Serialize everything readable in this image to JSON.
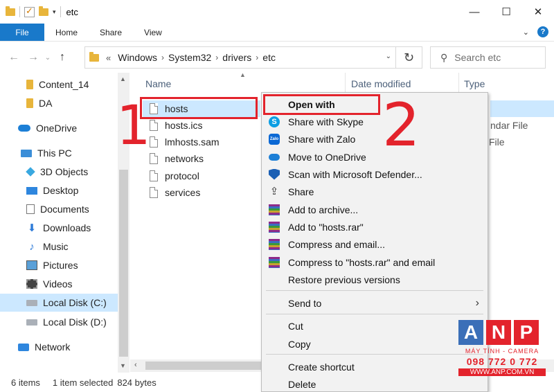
{
  "window": {
    "title": "etc",
    "minimize_icon": "minimize-icon",
    "maximize_icon": "maximize-icon",
    "close_icon": "close-icon"
  },
  "ribbon": {
    "tabs": [
      {
        "label": "File"
      },
      {
        "label": "Home"
      },
      {
        "label": "Share"
      },
      {
        "label": "View"
      }
    ],
    "help_glyph": "?"
  },
  "address": {
    "prefix": "«",
    "crumbs": [
      "Windows",
      "System32",
      "drivers",
      "etc"
    ],
    "search_placeholder": "Search etc"
  },
  "nav": {
    "items": [
      {
        "label": "Content_14",
        "icon": "folder-icon"
      },
      {
        "label": "DA",
        "icon": "folder-icon"
      },
      {
        "label": "OneDrive",
        "icon": "onedrive-icon"
      },
      {
        "label": "This PC",
        "icon": "pc-icon"
      },
      {
        "label": "3D Objects",
        "icon": "cube-icon"
      },
      {
        "label": "Desktop",
        "icon": "desktop-icon"
      },
      {
        "label": "Documents",
        "icon": "documents-icon"
      },
      {
        "label": "Downloads",
        "icon": "download-icon"
      },
      {
        "label": "Music",
        "icon": "music-icon"
      },
      {
        "label": "Pictures",
        "icon": "pictures-icon"
      },
      {
        "label": "Videos",
        "icon": "videos-icon"
      },
      {
        "label": "Local Disk (C:)",
        "icon": "disk-icon",
        "selected": true
      },
      {
        "label": "Local Disk (D:)",
        "icon": "disk-icon"
      },
      {
        "label": "Network",
        "icon": "network-icon"
      }
    ]
  },
  "files": {
    "columns": [
      "Name",
      "Date modified",
      "Type"
    ],
    "items": [
      {
        "name": "hosts",
        "selected": true
      },
      {
        "name": "hosts.ics"
      },
      {
        "name": "lmhosts.sam"
      },
      {
        "name": "networks"
      },
      {
        "name": "protocol"
      },
      {
        "name": "services"
      }
    ],
    "type_fragments": [
      "ndar File",
      "File"
    ]
  },
  "status": {
    "count": "6 items",
    "selected": "1 item selected",
    "size": "824 bytes"
  },
  "context_menu": {
    "items": [
      {
        "label": "Open with",
        "icon": "none"
      },
      {
        "label": "Share with Skype",
        "icon": "skype-icon"
      },
      {
        "label": "Share with Zalo",
        "icon": "zalo-icon"
      },
      {
        "label": "Move to OneDrive",
        "icon": "onedrive-icon"
      },
      {
        "label": "Scan with Microsoft Defender...",
        "icon": "defender-icon"
      },
      {
        "label": "Share",
        "icon": "share-icon"
      },
      {
        "label": "Add to archive...",
        "icon": "winrar-icon"
      },
      {
        "label": "Add to \"hosts.rar\"",
        "icon": "winrar-icon"
      },
      {
        "label": "Compress and email...",
        "icon": "winrar-icon"
      },
      {
        "label": "Compress to \"hosts.rar\" and email",
        "icon": "winrar-icon"
      },
      {
        "label": "Restore previous versions",
        "icon": "none"
      },
      {
        "label": "Send to",
        "icon": "none"
      },
      {
        "label": "Cut",
        "icon": "none"
      },
      {
        "label": "Copy",
        "icon": "none"
      },
      {
        "label": "Create shortcut",
        "icon": "none"
      },
      {
        "label": "Delete",
        "icon": "none"
      }
    ],
    "zalo_glyph": "Zalo",
    "skype_glyph": "S"
  },
  "annotations": {
    "step1": "1",
    "step2": "2",
    "accent_color": "#e3232c"
  },
  "watermark": {
    "letters": [
      "A",
      "N",
      "P"
    ],
    "letter_colors": [
      "#3b6fb8",
      "#e3232c",
      "#e3232c"
    ],
    "tagline": "MÁY TÍNH - CAMERA",
    "phone": "098 772 0 772",
    "url": "WWW.ANP.COM.VN"
  },
  "colors": {
    "file_tab": "#1979ca",
    "selection": "#cce8ff"
  }
}
